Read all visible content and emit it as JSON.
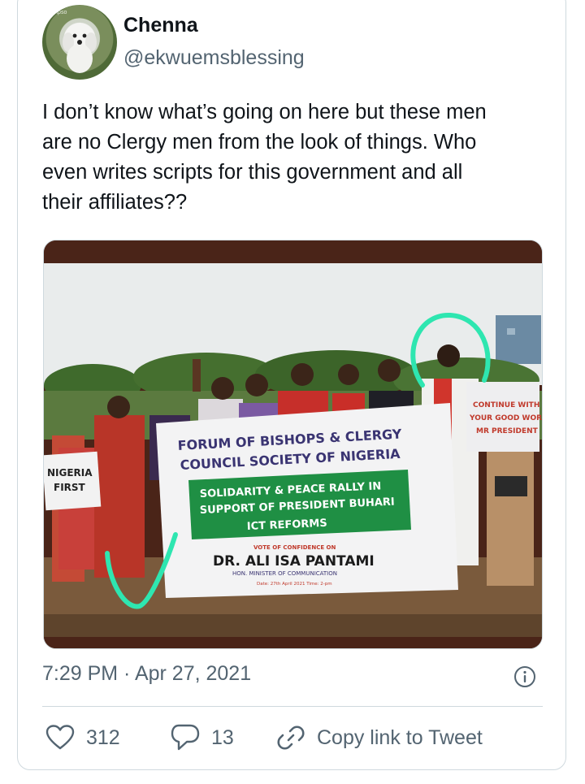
{
  "author": {
    "display_name": "Chenna",
    "handle": "@ekwuemsblessing",
    "avatar_watermark": "Hpso"
  },
  "tweet": {
    "text_lines": [
      "I don’t know what’s going on here but these men",
      "are no Clergy men from the look of things. Who",
      "even writes scripts for this government and all",
      "their affiliates??"
    ],
    "timestamp": "7:29 PM · Apr 27, 2021"
  },
  "photo": {
    "banner_line1": "FORUM OF BISHOPS & CLERGY",
    "banner_line2": "COUNCIL SOCIETY OF NIGERIA",
    "green_box_line1": "SOLIDARITY & PEACE RALLY IN",
    "green_box_line2": "SUPPORT OF PRESIDENT BUHARI",
    "green_box_line3": "ICT REFORMS",
    "vote_line": "VOTE OF CONFIDENCE ON",
    "name_line": "DR. ALI ISA PANTAMI",
    "title_line": "HON. MINISTER OF COMMUNICATION",
    "date_line": "Date: 27th April 2021   Time: 2-pm",
    "left_sign_line1": "NIGERIA",
    "left_sign_line2": "FIRST",
    "right_sign_line1": "CONTINUE WITH",
    "right_sign_line2": "YOUR GOOD WORK",
    "right_sign_line3": "MR PRESIDENT"
  },
  "actions": {
    "like_count": "312",
    "reply_count": "13",
    "copy_label": "Copy link to Tweet"
  },
  "colors": {
    "text_primary": "#0f1419",
    "text_secondary": "#536471",
    "border": "#cfd9de",
    "annotation": "#2ee6b0"
  },
  "icons": [
    "info-icon",
    "heart-icon",
    "reply-bubble-icon",
    "link-icon"
  ]
}
